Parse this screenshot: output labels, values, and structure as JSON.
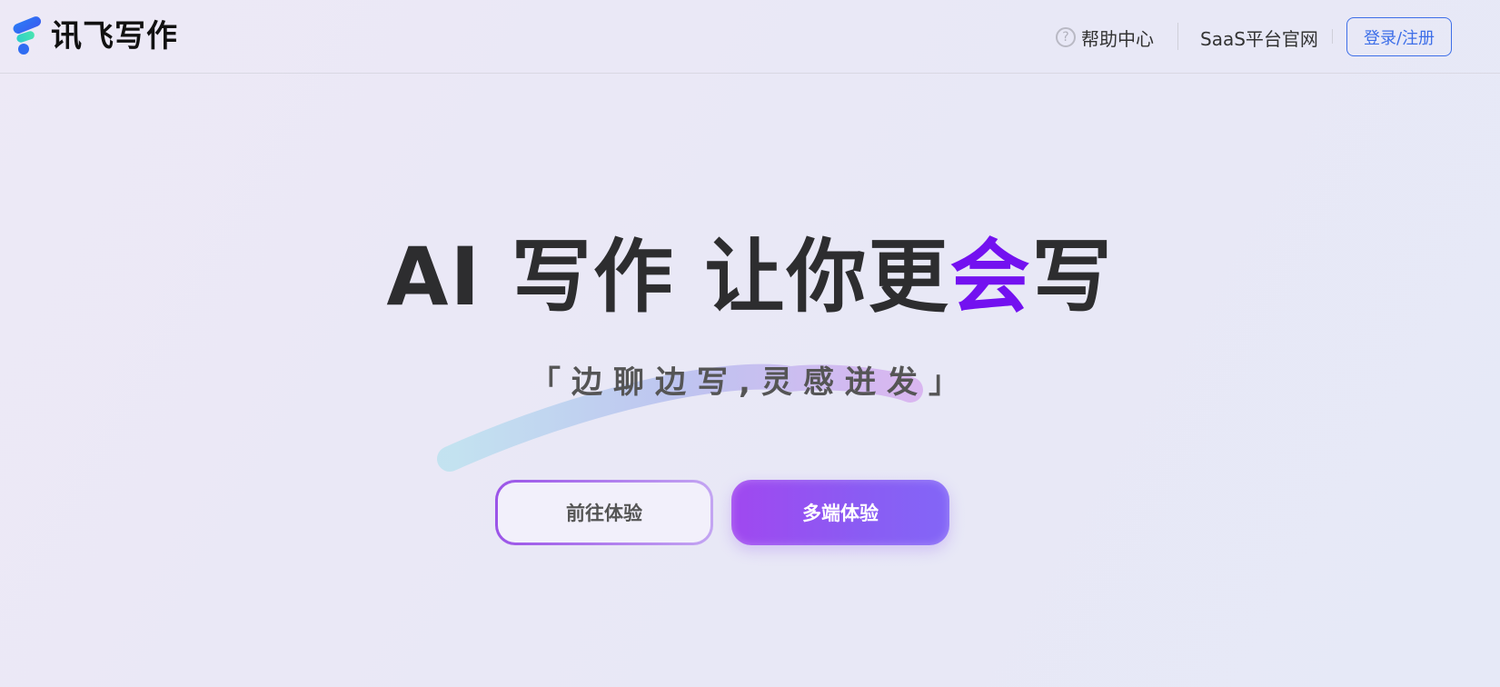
{
  "header": {
    "logo_text": "讯飞写作",
    "help_label": "帮助中心",
    "help_icon_glyph": "?",
    "saas_label": "SaaS平台官网",
    "login_label": "登录/注册"
  },
  "hero": {
    "title_main": "AI 写作 让你更",
    "title_accent": "会",
    "title_end": "写",
    "slogan": "「边聊边写,灵感迸发」",
    "primary_button": "前往体验",
    "secondary_button": "多端体验"
  },
  "colors": {
    "accent": "#7311f0",
    "link": "#3d6ee8",
    "button_gradient_start": "#a048f0",
    "button_gradient_end": "#8366f7"
  },
  "icons": {
    "logo": "iflytek-logo-icon",
    "help": "question-circle-icon",
    "decoration": "brush-stroke-icon"
  }
}
